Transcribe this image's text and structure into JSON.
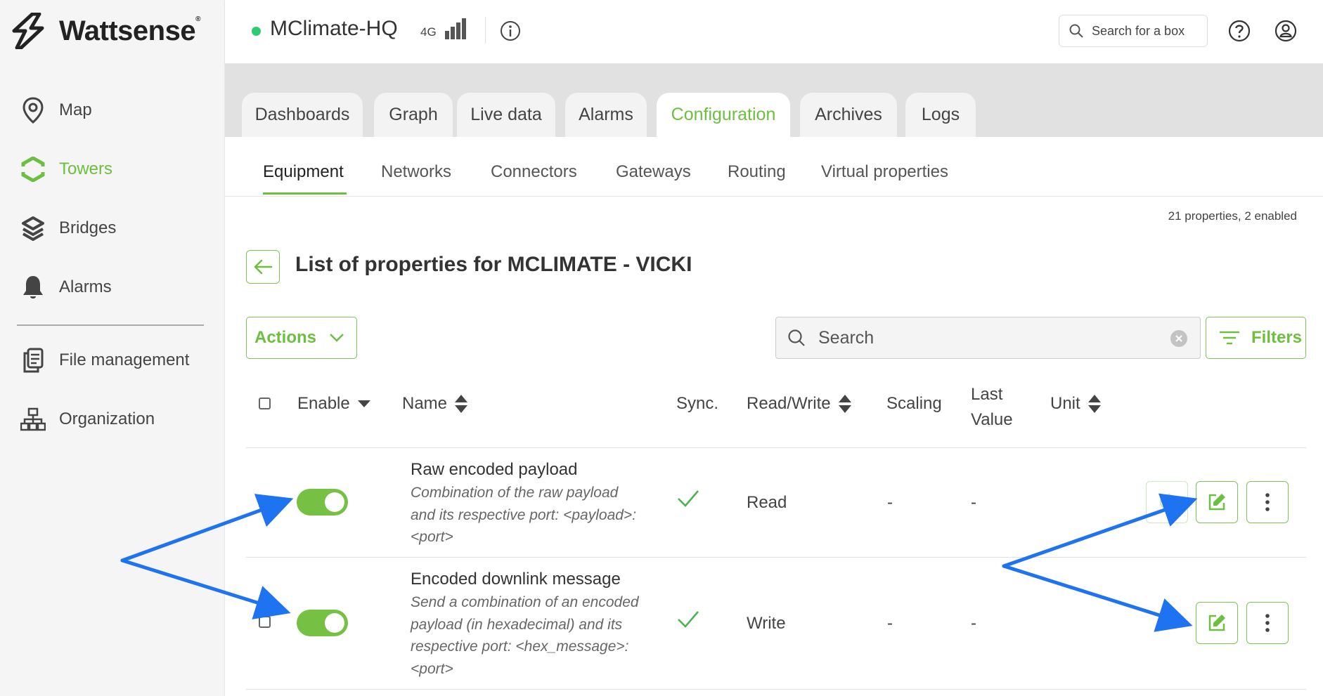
{
  "brand": {
    "name": "Wattsense",
    "mark": "®"
  },
  "sidebar": {
    "items": [
      {
        "label": "Map",
        "icon": "map-pin-icon",
        "active": false
      },
      {
        "label": "Towers",
        "icon": "towers-icon",
        "active": true
      },
      {
        "label": "Bridges",
        "icon": "bridges-icon",
        "active": false
      },
      {
        "label": "Alarms",
        "icon": "bell-icon",
        "active": false
      },
      {
        "label": "File management",
        "icon": "file-management-icon",
        "active": false
      },
      {
        "label": "Organization",
        "icon": "organization-icon",
        "active": false
      }
    ]
  },
  "header": {
    "box_name": "MClimate-HQ",
    "status_color": "#2ecc71",
    "network": "4G",
    "search_placeholder": "Search for a box"
  },
  "tabs": [
    {
      "label": "Dashboards",
      "active": false
    },
    {
      "label": "Graph",
      "active": false
    },
    {
      "label": "Live data",
      "active": false
    },
    {
      "label": "Alarms",
      "active": false
    },
    {
      "label": "Configuration",
      "active": true
    },
    {
      "label": "Archives",
      "active": false
    },
    {
      "label": "Logs",
      "active": false
    }
  ],
  "subtabs": [
    {
      "label": "Equipment",
      "active": true
    },
    {
      "label": "Networks",
      "active": false
    },
    {
      "label": "Connectors",
      "active": false
    },
    {
      "label": "Gateways",
      "active": false
    },
    {
      "label": "Routing",
      "active": false
    },
    {
      "label": "Virtual properties",
      "active": false
    }
  ],
  "summary": "21 properties, 2 enabled",
  "page_title": "List of properties for MCLIMATE - VICKI",
  "toolbar": {
    "actions_label": "Actions",
    "search_placeholder": "Search",
    "filters_label": "Filters"
  },
  "table": {
    "columns": {
      "enable": "Enable",
      "name": "Name",
      "sync": "Sync.",
      "read_write": "Read/Write",
      "scaling": "Scaling",
      "last_value_1": "Last",
      "last_value_2": "Value",
      "unit": "Unit"
    },
    "rows": [
      {
        "enabled": true,
        "name": "Raw encoded payload",
        "description": "Combination of the raw payload and its respective port: <payload>:<port>",
        "synced": true,
        "read_write": "Read",
        "scaling": "-",
        "last_value": "-"
      },
      {
        "enabled": true,
        "name": "Encoded downlink message",
        "description": "Send a combination of an encoded payload (in hexadecimal) and its respective port: <hex_message>:<port>",
        "synced": true,
        "read_write": "Write",
        "scaling": "-",
        "last_value": "-"
      }
    ]
  },
  "colors": {
    "accent": "#6cbf3f",
    "toggle_on": "#76c043",
    "annotation_arrow": "#1e73f0"
  }
}
